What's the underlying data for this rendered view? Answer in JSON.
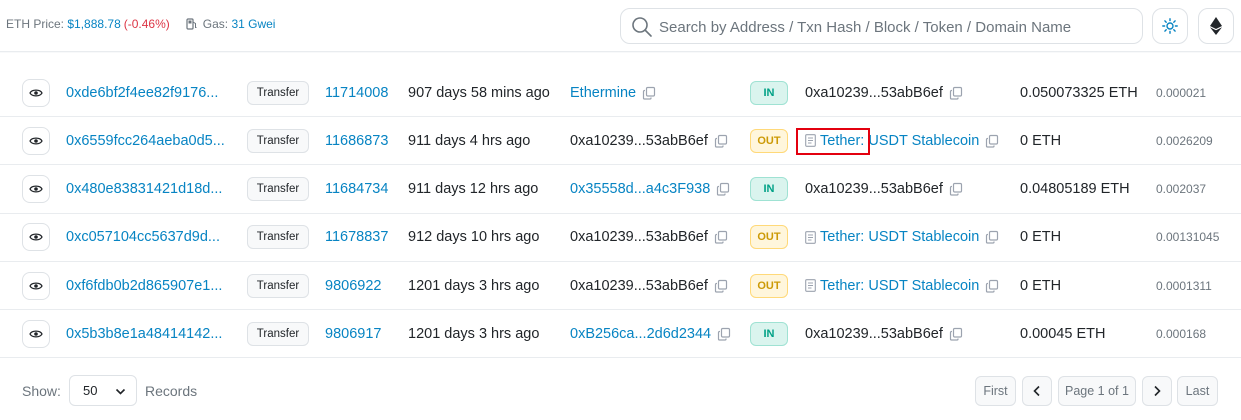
{
  "topbar": {
    "eth_price_label": "ETH Price:",
    "eth_price_value": "$1,888.78",
    "eth_price_change": "(-0.46%)",
    "gas_label": "Gas:",
    "gas_value": "31 Gwei",
    "search_placeholder": "Search by Address / Txn Hash / Block / Token / Domain Name"
  },
  "rows": [
    {
      "hash": "0xde6bf2f4ee82f9176...",
      "method": "Transfer",
      "block": "11714008",
      "age": "907 days 58 mins ago",
      "from": "Ethermine",
      "direction": "IN",
      "to": "0xa10239...53abB6ef",
      "value": "0.050073325 ETH",
      "fee": "0.000021"
    },
    {
      "hash": "0x6559fcc264aeba0d5...",
      "method": "Transfer",
      "block": "11686873",
      "age": "911 days 4 hrs ago",
      "from": "0xa10239...53abB6ef",
      "direction": "OUT",
      "to": "Tether: USDT Stablecoin",
      "value": "0 ETH",
      "fee": "0.0026209"
    },
    {
      "hash": "0x480e83831421d18d...",
      "method": "Transfer",
      "block": "11684734",
      "age": "911 days 12 hrs ago",
      "from": "0x35558d...a4c3F938",
      "direction": "IN",
      "to": "0xa10239...53abB6ef",
      "value": "0.04805189 ETH",
      "fee": "0.002037"
    },
    {
      "hash": "0xc057104cc5637d9d...",
      "method": "Transfer",
      "block": "11678837",
      "age": "912 days 10 hrs ago",
      "from": "0xa10239...53abB6ef",
      "direction": "OUT",
      "to": "Tether: USDT Stablecoin",
      "value": "0 ETH",
      "fee": "0.00131045"
    },
    {
      "hash": "0xf6fdb0b2d865907e1...",
      "method": "Transfer",
      "block": "9806922",
      "age": "1201 days 3 hrs ago",
      "from": "0xa10239...53abB6ef",
      "direction": "OUT",
      "to": "Tether: USDT Stablecoin",
      "value": "0 ETH",
      "fee": "0.0001311"
    },
    {
      "hash": "0x5b3b8e1a48414142...",
      "method": "Transfer",
      "block": "9806917",
      "age": "1201 days 3 hrs ago",
      "from": "0xB256ca...2d6d2344",
      "direction": "IN",
      "to": "0xa10239...53abB6ef",
      "value": "0.00045 ETH",
      "fee": "0.000168"
    }
  ],
  "footer": {
    "show_label": "Show:",
    "page_size": "50",
    "records_label": "Records",
    "first_label": "First",
    "page_info": "Page 1 of 1",
    "last_label": "Last"
  },
  "colors": {
    "link": "#0784c3",
    "negative": "#dc3545",
    "in_badge": "#00a186",
    "out_badge": "#cc9a06",
    "highlight": "#e3000f"
  }
}
